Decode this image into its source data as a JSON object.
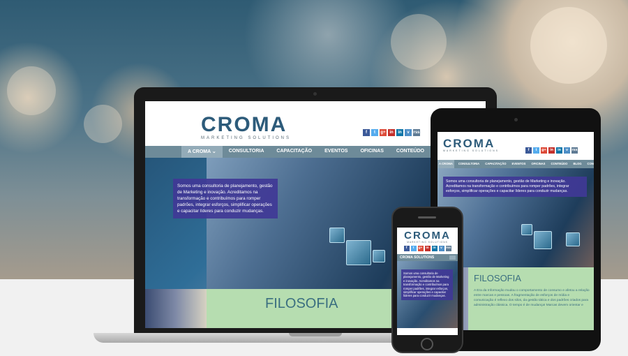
{
  "brand": {
    "logo": "CROMA",
    "tagline": "MARKETING SOLUTIONS"
  },
  "social": [
    "f",
    "t",
    "g+",
    "in",
    "in",
    "v",
    "rss"
  ],
  "nav": [
    {
      "label": "A CROMA ⌄",
      "active": true
    },
    {
      "label": "CONSULTORIA",
      "active": false
    },
    {
      "label": "CAPACITAÇÃO",
      "active": false
    },
    {
      "label": "EVENTOS",
      "active": false
    },
    {
      "label": "OFICINAS",
      "active": false
    },
    {
      "label": "CONTEÚDO",
      "active": false
    },
    {
      "label": "BLOG",
      "active": false
    },
    {
      "label": "CONT",
      "active": false
    }
  ],
  "tablet_nav": [
    "A CROMA",
    "CONSULTORIA",
    "CAPACITAÇÃO",
    "EVENTOS",
    "OFICINAS",
    "CONTEÚDO",
    "BLOG",
    "CONTATO"
  ],
  "hero_text": "Somos uma consultoria de planejamento, gestão de Marketing e inovação. Acreditamos na transformação e contribuímos para romper padrões, integrar esforços, simplificar operações e capacitar líderes para conduzir mudanças.",
  "filosofia_title": "FILOSOFIA",
  "filosofia_text": "A Era da Informação mudou o comportamento de consumo e afetou a relação entre marcas e pessoas. A fragmentação de esforços de mídia e comunicação é reflexo dos silos, da gestão tática e dos padrões criados para administração clássica. O tempo é de mudança! Marcas devem orientar e",
  "mobile_menu": "CROMA SOLUTIONS",
  "colors": {
    "nav": "#6e8b99",
    "box": "#403896",
    "filosofia": "#b6ddb0",
    "logo": "#2d5b7a"
  }
}
